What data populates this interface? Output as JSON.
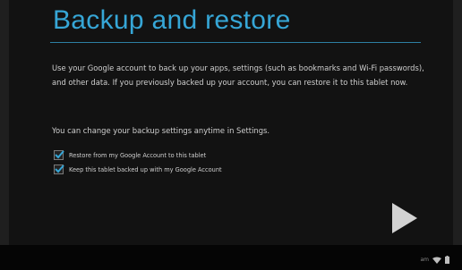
{
  "header": {
    "title": "Backup and restore"
  },
  "body": {
    "description": "Use your Google account to back up your apps, settings (such as bookmarks and Wi-Fi passwords), and other data. If you previously backed up your account, you can restore it to this tablet now.",
    "settings_note": "You can change your backup settings anytime in Settings."
  },
  "options": [
    {
      "label": "Restore from my Google Account to this tablet",
      "checked": true
    },
    {
      "label": "Keep this tablet backed up with my Google Account",
      "checked": true
    }
  ],
  "navigation": {
    "next_icon": "play-arrow-icon"
  },
  "status_bar": {
    "time": "am",
    "icons": [
      "wifi-icon",
      "battery-icon"
    ]
  },
  "colors": {
    "accent": "#36a6d6",
    "background": "#121212",
    "text": "#cfcfcf"
  }
}
